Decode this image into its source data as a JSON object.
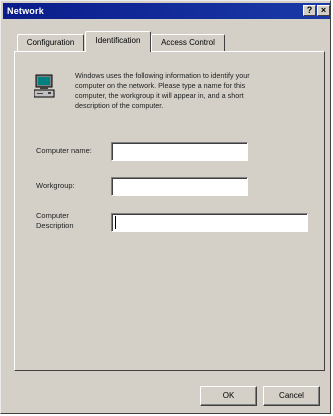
{
  "window": {
    "title": "Network",
    "help_label": "?",
    "close_label": "×",
    "help_icon": "help-icon",
    "close_icon": "close-icon"
  },
  "tabs": [
    {
      "label": "Configuration",
      "active": false
    },
    {
      "label": "Identification",
      "active": true
    },
    {
      "label": "Access Control",
      "active": false
    }
  ],
  "identification": {
    "icon": "computer-icon",
    "info_lines": [
      "Windows uses the following information to identify your",
      "computer on the network. Please type a name for this",
      "computer, the workgroup it will appear in, and a short",
      "description of the computer."
    ],
    "fields": {
      "computer_name": {
        "label": "Computer name:",
        "value": ""
      },
      "workgroup": {
        "label": "Workgroup:",
        "value": ""
      },
      "computer_description": {
        "label_line1": "Computer",
        "label_line2": "Description",
        "value": ""
      }
    }
  },
  "buttons": {
    "ok": "OK",
    "cancel": "Cancel"
  },
  "colors": {
    "titlebar": "#0a1c8a",
    "face": "#d4d0c8"
  }
}
